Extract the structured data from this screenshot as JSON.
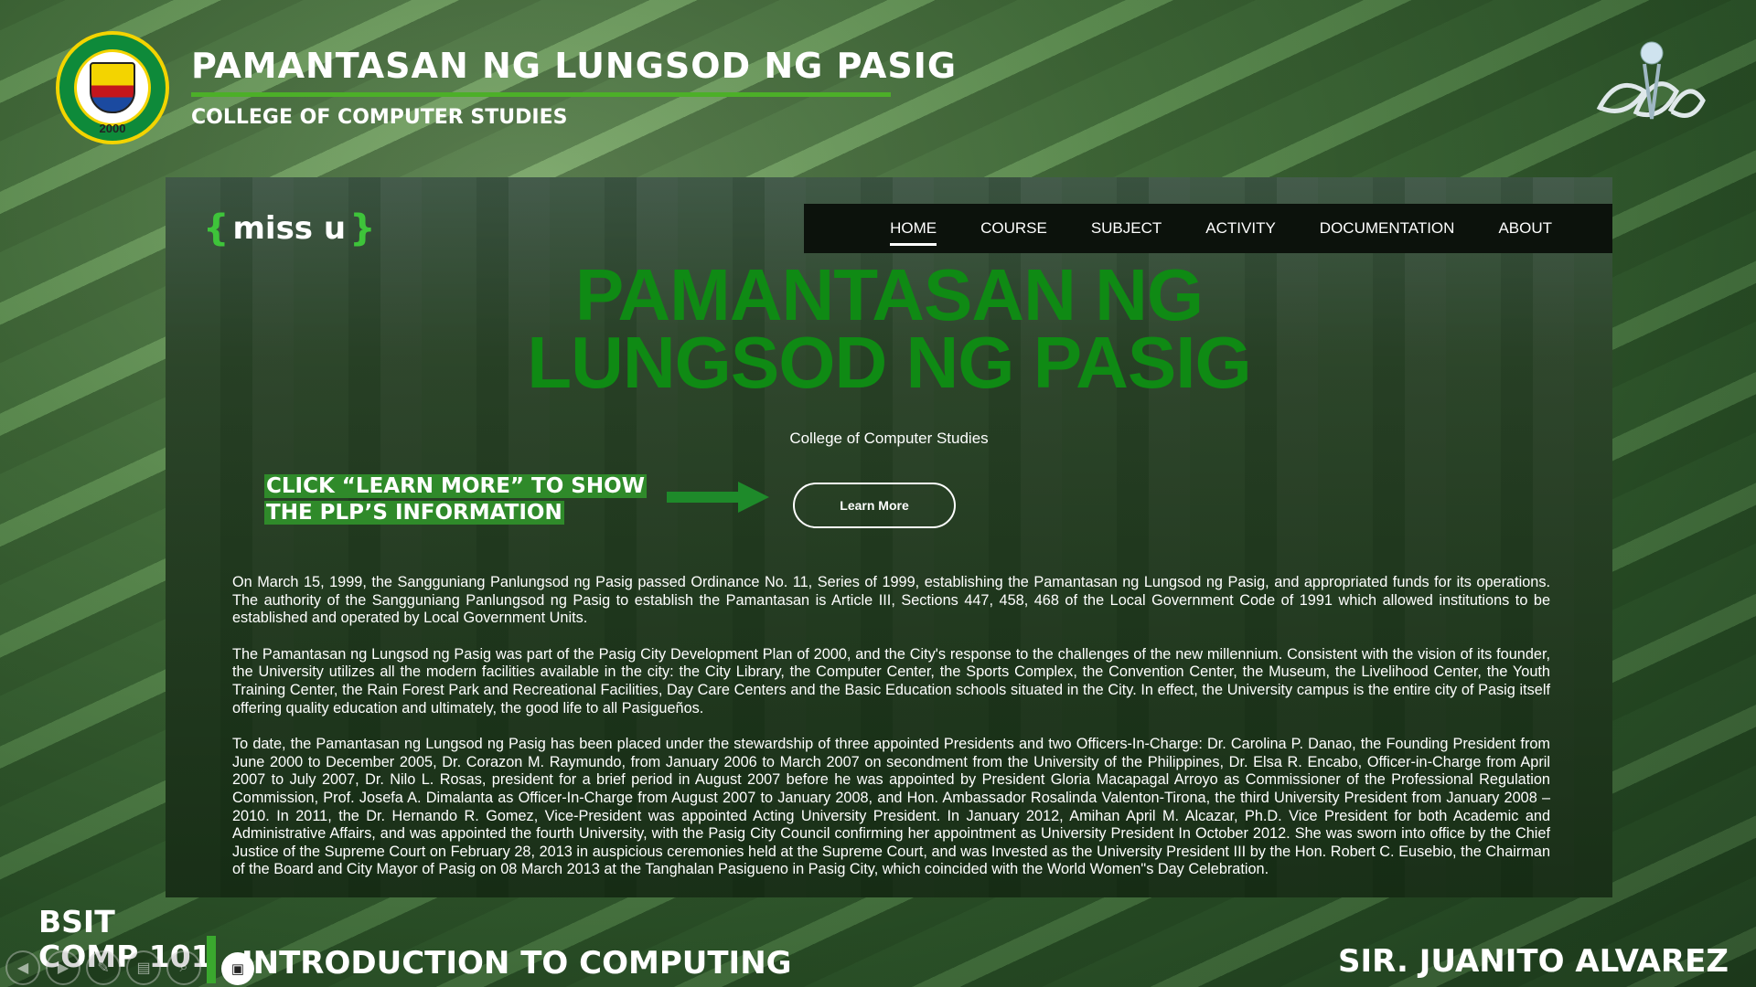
{
  "slide": {
    "university_title": "PAMANTASAN NG LUNGSOD NG PASIG",
    "college_title": "COLLEGE OF COMPUTER STUDIES",
    "seal_year": "2000"
  },
  "site": {
    "logo_text": "miss u",
    "nav": [
      "HOME",
      "COURSE",
      "SUBJECT",
      "ACTIVITY",
      "DOCUMENTATION",
      "ABOUT"
    ],
    "active_nav": "HOME",
    "hero_line1": "PAMANTASAN NG",
    "hero_line2": "LUNGSOD NG PASIG",
    "hero_subtitle": "College of Computer Studies",
    "callout_line1": "CLICK “LEARN MORE” TO SHOW",
    "callout_line2": "THE PLP’S INFORMATION",
    "learn_more": "Learn More",
    "paragraphs": [
      "On March 15, 1999, the Sangguniang Panlungsod ng Pasig passed Ordinance No. 11, Series of 1999, establishing the Pamantasan ng Lungsod ng Pasig, and appropriated funds for its operations. The authority of the Sangguniang Panlungsod ng Pasig to establish the Pamantasan is Article III, Sections 447, 458, 468 of the Local Government Code of 1991 which allowed institutions to be established and operated by Local Government Units.",
      "The Pamantasan ng Lungsod ng Pasig was part of the Pasig City Development Plan of 2000, and the City's response to the challenges of the new millennium. Consistent with the vision of its founder, the University utilizes all the modern facilities available in the city: the City Library, the Computer Center, the Sports Complex, the Convention Center, the Museum, the Livelihood Center, the Youth Training Center, the Rain Forest Park and Recreational Facilities, Day Care Centers and the Basic Education schools situated in the City. In effect, the University campus is the entire city of Pasig itself offering quality education and ultimately, the good life to all Pasigueños.",
      "To date, the Pamantasan ng Lungsod ng Pasig has been placed under the stewardship of three appointed Presidents and two Officers-In-Charge: Dr. Carolina P. Danao, the Founding President from June 2000 to December 2005, Dr. Corazon M. Raymundo, from January 2006 to March 2007 on secondment from the University of the Philippines, Dr. Elsa R. Encabo, Officer-in-Charge from April 2007 to July 2007, Dr. Nilo L. Rosas, president for a brief period in August 2007 before he was appointed by President Gloria Macapagal Arroyo as Commissioner of the Professional Regulation Commission, Prof. Josefa A. Dimalanta as Officer-In-Charge from August 2007 to January 2008, and Hon. Ambassador Rosalinda Valenton-Tirona, the third University President from January 2008 – 2010. In 2011, the Dr. Hernando R. Gomez, Vice-President was appointed Acting University President. In January 2012, Amihan April M. Alcazar, Ph.D. Vice President for both Academic and Administrative Affairs, and was appointed the fourth University, with the Pasig City Council confirming her appointment as University President In October 2012. She was sworn into office by the Chief Justice of the Supreme Court on February 28, 2013 in auspicious ceremonies held at the Supreme Court, and was Invested as the University President III by the Hon. Robert C. Eusebio, the Chairman of the Board and City Mayor of Pasig on 08 March 2013 at the Tanghalan Pasigueno in Pasig City, which coincided with the World Women\"s Day Celebration."
    ]
  },
  "footer": {
    "program": "BSIT",
    "course_code": "COMP 101",
    "course_name": "INTRODUCTION TO COMPUTING",
    "instructor": "SIR. JUANITO ALVAREZ"
  },
  "player_icons": [
    "previous-icon",
    "next-icon",
    "pen-icon",
    "page-icon",
    "zoom-icon",
    "camera-icon"
  ],
  "colors": {
    "accent_green": "#0f8a14",
    "rule_green": "#4caf28",
    "callout_bg": "#2f8a2a",
    "navbar_bg": "#0c120c"
  }
}
